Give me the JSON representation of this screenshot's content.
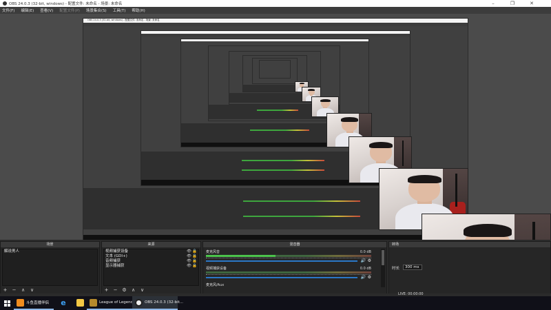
{
  "window": {
    "title": "OBS 24.0.3 (32-bit, windows) - 配置文件: 未命名 - 场景: 未命名",
    "minimize_icon": "minimize-icon",
    "maximize_icon": "maximize-icon",
    "close_icon": "close-icon"
  },
  "menu": [
    {
      "label": "文件(F)",
      "enabled": true
    },
    {
      "label": "编辑(E)",
      "enabled": true
    },
    {
      "label": "查看(V)",
      "enabled": true
    },
    {
      "label": "配置文件(P)",
      "enabled": false
    },
    {
      "label": "场景集合(S)",
      "enabled": true
    },
    {
      "label": "工具(T)",
      "enabled": true
    },
    {
      "label": "帮助(H)",
      "enabled": true
    }
  ],
  "preview": {
    "nested_title": "OBS 24.0.3 (32-bit, windows) - 配置文件: 未命名 - 场景: 未命名"
  },
  "scenes": {
    "header": "场景",
    "items": [
      "解说男人"
    ],
    "footer_icons": [
      "+",
      "−",
      "∧",
      "∨"
    ]
  },
  "sources": {
    "header": "来源",
    "items": [
      "视频捕获设备",
      "文本 (GDI+)",
      "音频捕获",
      "显示器捕获"
    ],
    "eye_icon": "👁",
    "lock_icon": "🔒",
    "footer_icons": [
      "+",
      "−",
      "⚙",
      "∧",
      "∨"
    ]
  },
  "mixer": {
    "header": "混音器",
    "tracks": [
      {
        "name": "麦克风音",
        "db": "0.0 dB",
        "level": 0.42,
        "volume": 0.98
      },
      {
        "name": "视频捕获设备",
        "db": "0.0 dB",
        "level": 0.0,
        "volume": 0.98
      },
      {
        "name": "麦克风/Aux",
        "db": "",
        "level": 0.0,
        "volume": 0.98
      }
    ],
    "volume_icon": "🔊",
    "gear_icon": "⚙"
  },
  "transitions": {
    "header": "转场",
    "duration_label": "时长",
    "duration_value": "300 ms"
  },
  "status": {
    "text": "LIVE: 00:00:00"
  },
  "taskbar": {
    "items": [
      {
        "label": "斗鱼直播伴侣",
        "icon": "douyu-icon",
        "state": "running"
      },
      {
        "label": "",
        "icon": "ie-icon",
        "state": "none"
      },
      {
        "label": "",
        "icon": "folder-icon",
        "state": "none"
      },
      {
        "label": "League of Legends",
        "icon": "lol-icon",
        "state": "running"
      },
      {
        "label": "OBS 24.0.3 (32-bit...",
        "icon": "obs-icon",
        "state": "active"
      }
    ]
  }
}
